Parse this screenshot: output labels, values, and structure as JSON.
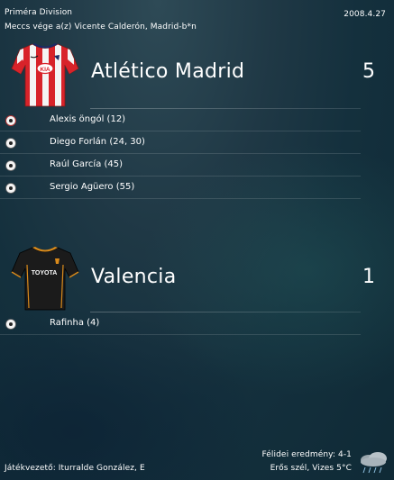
{
  "header": {
    "league": "Priméra Division",
    "date": "2008.4.27",
    "venue": "Meccs vége a(z) Vicente Calderón, Madrid-b*n"
  },
  "home": {
    "name": "Atlético Madrid",
    "score": "5",
    "kit_colors": {
      "stripe_red": "#d8232a",
      "stripe_white": "#f4f4f4",
      "sleeve": "#d8232a"
    },
    "scorers": [
      {
        "text": "Alexis öngól (12)",
        "icon": "own-goal-ball-icon"
      },
      {
        "text": "Diego Forlán (24, 30)",
        "icon": "ball-icon"
      },
      {
        "text": "Raúl García (45)",
        "icon": "ball-icon"
      },
      {
        "text": "Sergio Agüero (55)",
        "icon": "ball-icon"
      }
    ]
  },
  "away": {
    "name": "Valencia",
    "score": "1",
    "kit_colors": {
      "body": "#1b1b1b",
      "trim": "#d98a1b"
    },
    "shirt_sponsor": "TOYOTA",
    "scorers": [
      {
        "text": "Rafinha (4)",
        "icon": "ball-icon"
      }
    ]
  },
  "footer": {
    "referee": "Játékvezető: Iturralde González, E",
    "halftime": "Félidei eredmény: 4-1",
    "weather": "Erős szél, Vizes 5°C",
    "weather_icon": "rain-cloud-icon"
  },
  "colors": {
    "bg_top": "#2e4a56",
    "bg_bottom": "#0f2a36",
    "text": "#ffffff"
  }
}
